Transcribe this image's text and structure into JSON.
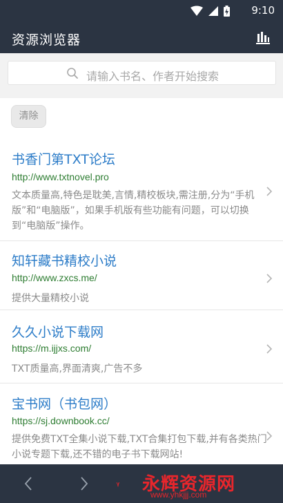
{
  "status_bar": {
    "time": "9:10"
  },
  "app_bar": {
    "title": "资源浏览器",
    "menu_icon": "bar-chart-icon"
  },
  "search": {
    "placeholder": "请输入书名、作者开始搜索"
  },
  "clear_button": {
    "label": "清除"
  },
  "results": [
    {
      "name": "书香门第TXT论坛",
      "url": "http://www.txtnovel.pro",
      "desc": "文本质量高,特色是耽美,言情,精校板块,需注册,分为“手机版”和“电脑版”，如果手机版有些功能有问题，可以切换到“电脑版”操作。"
    },
    {
      "name": "知轩藏书精校小说",
      "url": "http://www.zxcs.me/",
      "desc": "提供大量精校小说"
    },
    {
      "name": "久久小说下载网",
      "url": "https://m.ijjxs.com/",
      "desc": "TXT质量高,界面清爽,广告不多"
    },
    {
      "name": "宝书网（书包网）",
      "url": "https://sj.downbook.cc/",
      "desc": "提供免费TXT全集小说下载,TXT合集打包下载,并有各类热门小说专题下载,还不错的电子书下载网站!"
    }
  ],
  "bottom_bar": {
    "back_icon": "chevron-left-icon",
    "forward_icon": "chevron-right-icon"
  },
  "watermark": {
    "text": "永辉资源网",
    "url": "www.yhkjjj.com"
  },
  "colors": {
    "header": "#2b3442",
    "link": "#2c7cc8",
    "url": "#2e7d32",
    "watermark": "#e8262c"
  }
}
